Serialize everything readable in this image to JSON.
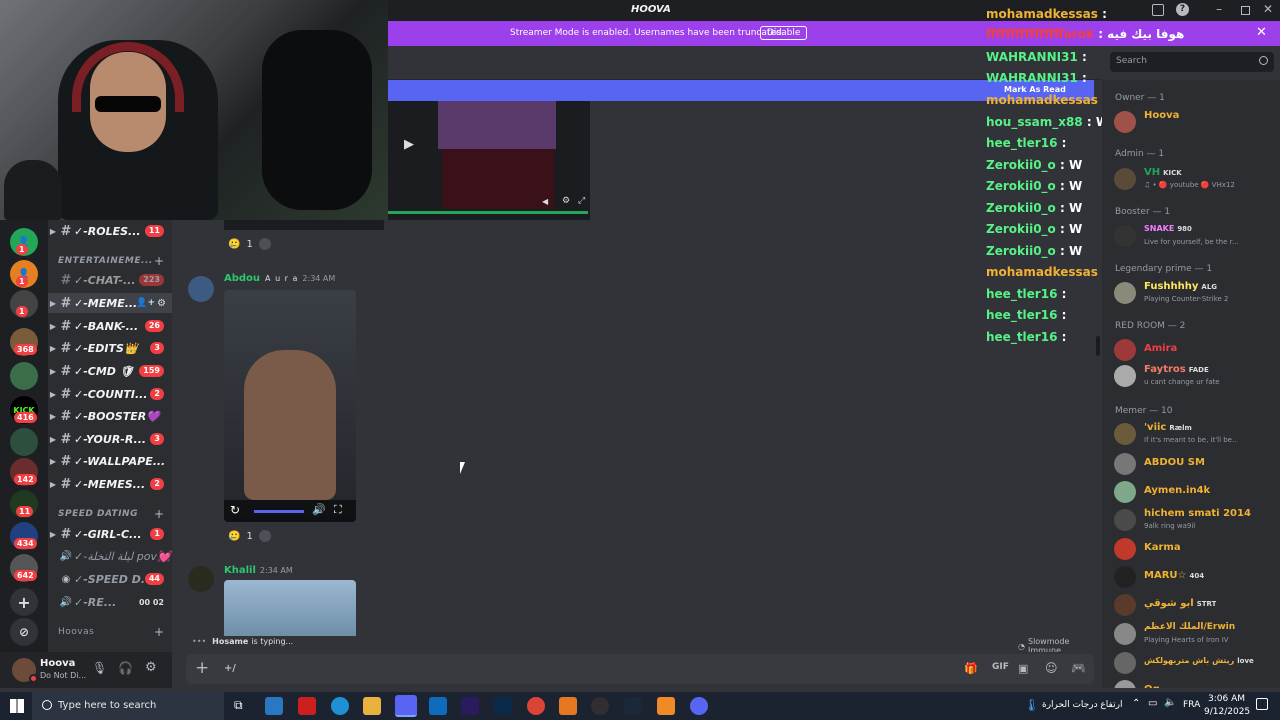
{
  "window": {
    "title": "HOOVA"
  },
  "banner": {
    "text": "Streamer Mode is enabled. Usernames have been truncated.",
    "button": "Disable"
  },
  "mark_as_read": "Mark As Read",
  "search": {
    "placeholder": "Search"
  },
  "colors": {
    "banner": "#9b40ea",
    "accent": "#5865f2",
    "online": "#23a55a",
    "badge": "#f23f43"
  },
  "servers": [
    {
      "badge": "1"
    },
    {
      "badge": "1"
    },
    {
      "badge": "1"
    },
    {
      "badge": "368"
    },
    {
      "badge": ""
    },
    {
      "label": "KICK",
      "badge": "416"
    },
    {
      "badge": "142"
    },
    {
      "badge": "11"
    },
    {
      "badge": "434"
    },
    {
      "badge": "642"
    }
  ],
  "channels": {
    "items": [
      {
        "name": "✓-ROLES...",
        "badge": "11"
      },
      {
        "name": "✓-CHAT-...",
        "badge": "223"
      },
      {
        "name": "✓-MEME...",
        "badge": ""
      },
      {
        "name": "✓-BANK-...",
        "badge": "26"
      },
      {
        "name": "✓-EDITS👑",
        "badge": "3"
      },
      {
        "name": "✓-CMD 🛡",
        "badge": "159"
      },
      {
        "name": "✓-COUNTI...",
        "badge": "2"
      },
      {
        "name": "✓-BOOSTER💜",
        "badge": ""
      },
      {
        "name": "✓-YOUR-R...",
        "badge": "3"
      },
      {
        "name": "✓-WALLPAPE...",
        "badge": ""
      },
      {
        "name": "✓-MEMES...",
        "badge": "2"
      },
      {
        "name": "✓-GIRL-C...",
        "badge": "1"
      },
      {
        "name": "✓-ليلة النخلة pov💓",
        "badge": ""
      },
      {
        "name": "✓-SPEED D...",
        "badge": "44"
      },
      {
        "name": "✓-RE...",
        "badge": "00 02"
      }
    ],
    "categories": [
      "ENTERTAINEME...",
      "SPEED DATING",
      "Hoovas"
    ]
  },
  "user": {
    "name": "Hoova",
    "status": "Do Not Di..."
  },
  "chat": {
    "reaction_count_1": "1",
    "reaction_count_2": "1",
    "msg1": {
      "author": "Abdou",
      "tag": "A u r a",
      "time": "2:34 AM"
    },
    "msg2": {
      "author": "Khalil",
      "time": "2:34 AM"
    },
    "typing": "is typing...",
    "typing_user": "Hosame",
    "slowmode": "Slowmode Immune",
    "input": "+/"
  },
  "members": {
    "categories": [
      "Owner — 1",
      "Admin — 1",
      "Booster — 1",
      "Legendary prime — 1",
      "RED ROOM — 2",
      "Memer — 10"
    ],
    "list": [
      {
        "name": "Hoova",
        "color": "#f0b232",
        "sub": "",
        "tag": ""
      },
      {
        "name": "VH",
        "color": "#23a55a",
        "sub": "♫ • 🔴 youtube 🔴 VHx12",
        "tag": "KICK"
      },
      {
        "name": "SNAKE",
        "color": "#f47fff",
        "sub": "Live for yourself, be the r...",
        "tag": "980"
      },
      {
        "name": "Fushhhhy",
        "color": "#fee75c",
        "sub": "Playing Counter-Strike 2",
        "tag": "ALG"
      },
      {
        "name": "Amira",
        "color": "#f23f43",
        "sub": "",
        "tag": ""
      },
      {
        "name": "Faytros",
        "color": "#f47b67",
        "sub": "u cant change ur fate",
        "tag": "FADE"
      },
      {
        "name": "'viic",
        "color": "#f0b232",
        "sub": "If it's meant to be, it'll be..",
        "tag": "Rælm"
      },
      {
        "name": "ABDOU SM",
        "color": "#f0b232",
        "sub": "",
        "tag": ""
      },
      {
        "name": "Aymen.in4k",
        "color": "#f0b232",
        "sub": "",
        "tag": ""
      },
      {
        "name": "hichem smati 2014",
        "color": "#f0b232",
        "sub": "9alk ring wa9il",
        "tag": ""
      },
      {
        "name": "Karma",
        "color": "#f0b232",
        "sub": "",
        "tag": ""
      },
      {
        "name": "MARU☆",
        "color": "#f0b232",
        "sub": "",
        "tag": "404"
      },
      {
        "name": "ابو شوقي",
        "color": "#f0b232",
        "sub": "",
        "tag": "STRT"
      },
      {
        "name": "الملك الاعظم/Erwin",
        "color": "#f0b232",
        "sub": "Playing Hearts of Iron IV",
        "tag": ""
      },
      {
        "name": "ريتش باش متربهولكش",
        "color": "#f0b232",
        "sub": "",
        "tag": "love"
      },
      {
        "name": "Og",
        "color": "#f0b232",
        "sub": "",
        "tag": ""
      }
    ]
  },
  "stream_chat": [
    {
      "user": "mohamadkessas",
      "color": "#f0b232",
      "text": ""
    },
    {
      "user": "ffffffffffffffffarok",
      "color": "#f23f43",
      "text": "هوفا بيك فيه"
    },
    {
      "user": "WAHRANNI31",
      "color": "#57f287",
      "text": ""
    },
    {
      "user": "WAHRANNI31",
      "color": "#57f287",
      "text": ""
    },
    {
      "user": "mohamadkessas",
      "color": "#f0b232",
      "text": ""
    },
    {
      "user": "hou_ssam_x88",
      "color": "#57f287",
      "text": "W"
    },
    {
      "user": "hee_tler16",
      "color": "#57f287",
      "text": ""
    },
    {
      "user": "Zerokii0_o",
      "color": "#57f287",
      "text": "W"
    },
    {
      "user": "Zerokii0_o",
      "color": "#57f287",
      "text": "W"
    },
    {
      "user": "Zerokii0_o",
      "color": "#57f287",
      "text": "W"
    },
    {
      "user": "Zerokii0_o",
      "color": "#57f287",
      "text": "W"
    },
    {
      "user": "Zerokii0_o",
      "color": "#57f287",
      "text": "W"
    },
    {
      "user": "mohamadkessas",
      "color": "#f0b232",
      "text": ""
    },
    {
      "user": "hee_tler16",
      "color": "#57f287",
      "text": ""
    },
    {
      "user": "hee_tler16",
      "color": "#57f287",
      "text": ""
    },
    {
      "user": "hee_tler16",
      "color": "#57f287",
      "text": ""
    }
  ],
  "taskbar": {
    "search": "Type here to search",
    "weather": "ارتفاع درجات الحرارة",
    "lang": "FRA",
    "time": "3:06 AM",
    "date": "9/12/2025"
  }
}
